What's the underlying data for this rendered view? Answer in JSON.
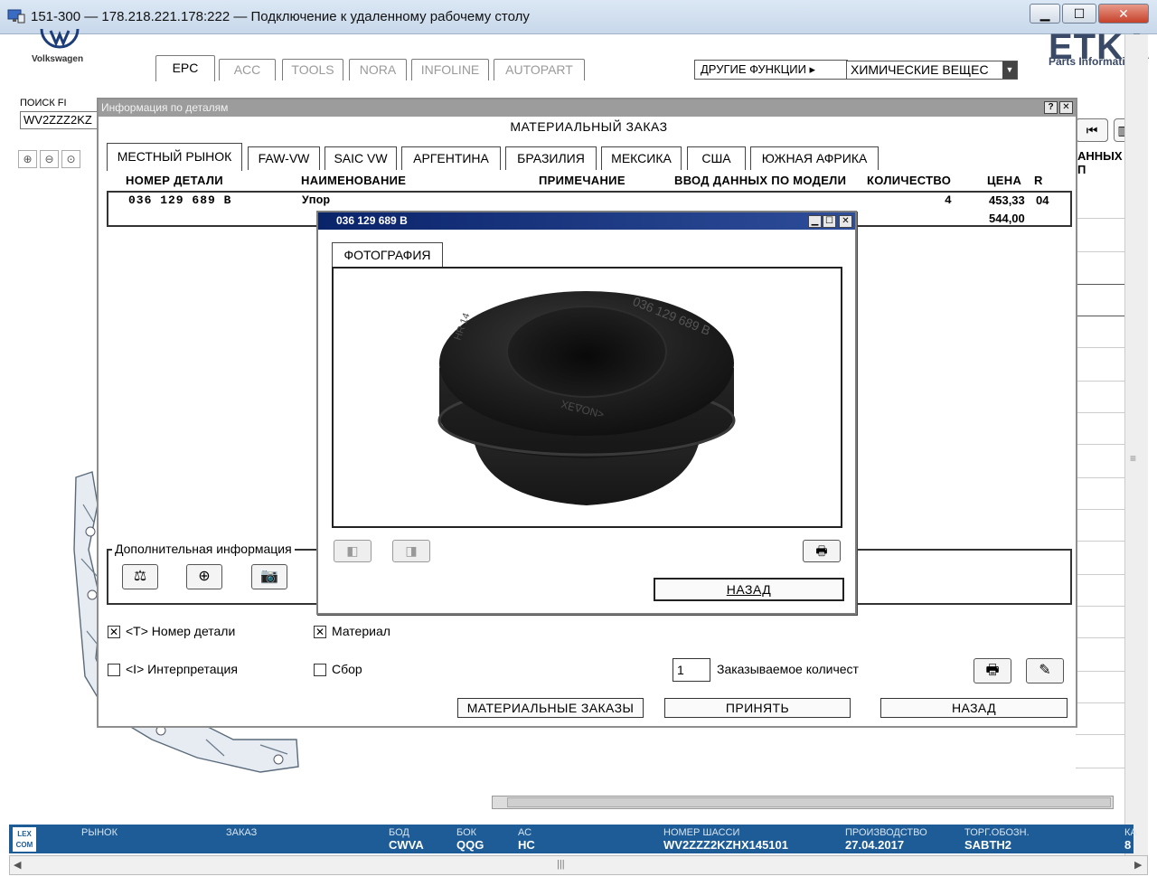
{
  "window": {
    "title": "151-300 — 178.218.221.178:222 — Подключение к удаленному рабочему столу",
    "minimize_glyph": "▁",
    "maximize_glyph": "☐",
    "close_glyph": "✕"
  },
  "app": {
    "brand": "Volkswagen",
    "logo_text": "ETKA",
    "logo_sub": "Parts Informati",
    "tabs": [
      "EPC",
      "ACC",
      "TOOLS",
      "NORA",
      "INFOLINE",
      "AUTOPART"
    ],
    "active_tab": "EPC",
    "other_functions_label": "ДРУГИЕ ФУНКЦИИ ▸",
    "chem_select_value": "ХИМИЧЕСКИЕ ВЕЩЕС",
    "search_label": "ПОИСК FI",
    "search_value": "WV2ZZZ2KZ",
    "bg_column_header": "АННЫХ П"
  },
  "status": {
    "logo": "LEX COM",
    "market_label": "РЫНОК",
    "order_label": "ЗАКАЗ",
    "bod_label": "БОД",
    "bod_value": "CWVA",
    "bok_label": "БОК",
    "bok_value": "QQG",
    "ac_label": "АС",
    "ac_value": "HC",
    "chassis_label": "НОМЕР ШАССИ",
    "chassis_value": "WV2ZZZ2KZHX145101",
    "production_label": "ПРОИЗВОДСТВО",
    "production_value": "27.04.2017",
    "trade_label": "ТОРГ.ОБОЗН.",
    "trade_value": "SABTH2",
    "extra_label": "КА",
    "extra_value": "8"
  },
  "parts_window": {
    "title": "Информация по деталям",
    "help_glyph": "?",
    "close_glyph": "✕",
    "header": "МАТЕРИАЛЬНЫЙ ЗАКАЗ",
    "market_tabs": [
      "МЕСТНЫЙ РЫНОК",
      "FAW-VW",
      "SAIC VW",
      "АРГЕНТИНА",
      "БРАЗИЛИЯ",
      "МЕКСИКА",
      "США",
      "ЮЖНАЯ АФРИКА"
    ],
    "columns": {
      "part_no": "НОМЕР ДЕТАЛИ",
      "name": "НАИМЕНОВАНИЕ",
      "note": "ПРИМЕЧАНИЕ",
      "model_input": "ВВОД ДАННЫХ ПО МОДЕЛИ",
      "qty": "КОЛИЧЕСТВО",
      "price": "ЦЕНА",
      "r": "R"
    },
    "row": {
      "part_no": "036 129 689 B",
      "name": "Упор",
      "qty": "4",
      "price": "453,33",
      "price2": "544,00",
      "r": "04"
    },
    "additional_info_label": "Дополнительная информация",
    "checkboxes": {
      "part_no": {
        "label": "<T> Номер детали",
        "checked": true
      },
      "material": {
        "label": "Материал",
        "checked": true
      },
      "interpretation": {
        "label": "<I> Интерпретация",
        "checked": false
      },
      "assembly": {
        "label": "Сбор",
        "checked": false
      }
    },
    "order_qty": "1",
    "order_qty_label": "Заказываемое количест",
    "btn_material_orders": "МАТЕРИАЛЬНЫЕ ЗАКАЗЫ",
    "btn_accept": "ПРИНЯТЬ",
    "btn_back": "НАЗАД"
  },
  "photo_dialog": {
    "title": "036 129 689 B",
    "tab_label": "ФОТОГРАФИЯ",
    "btn_back": "НАЗАД",
    "part_marking": "036 129 689 B",
    "part_marking2": "<NOΔ∃Χ",
    "part_marking3": "HR 14"
  },
  "colors": {
    "status_bar": "#1d5c96",
    "dialog_title": "#0a246a",
    "window_title_gray": "#9c9c9c"
  }
}
